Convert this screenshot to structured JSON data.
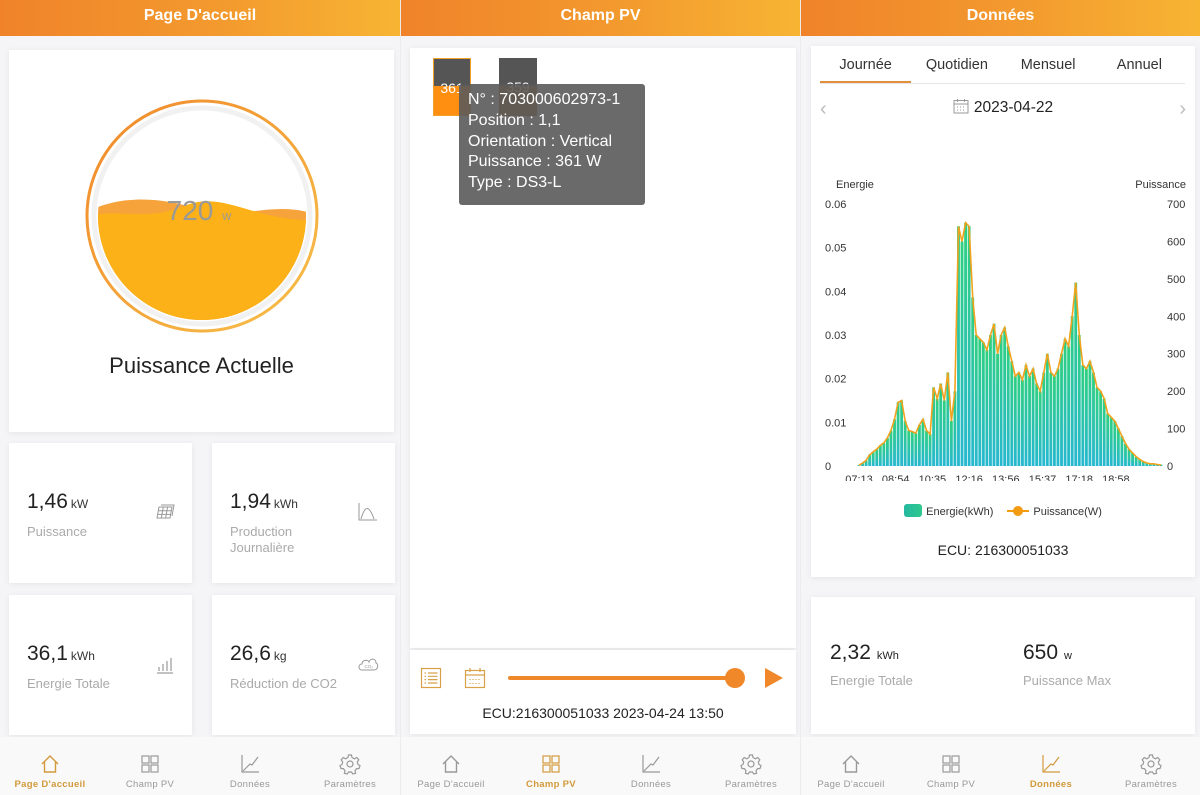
{
  "screens": {
    "home": {
      "title": "Page D'accueil",
      "gauge": {
        "value": "720",
        "unit": "W",
        "fill_fraction": 0.45,
        "label": "Puissance Actuelle"
      },
      "stats": [
        {
          "value": "1,46",
          "unit": "kW",
          "label": "Puissance",
          "icon": "solar-panel-icon"
        },
        {
          "value": "1,94",
          "unit": "kWh",
          "label": "Production Journalière",
          "icon": "bell-curve-icon"
        },
        {
          "value": "36,1",
          "unit": "kWh",
          "label": "Energie Totale",
          "icon": "bar-chart-icon"
        },
        {
          "value": "26,6",
          "unit": "kg",
          "label": "Réduction de CO2",
          "icon": "co2-cloud-icon"
        }
      ]
    },
    "field": {
      "title": "Champ PV",
      "panels": [
        {
          "value": "361",
          "fill_fraction": 0.52,
          "selected": true
        },
        {
          "value": "359",
          "fill_fraction": 0.52,
          "selected": false
        }
      ],
      "tooltip": {
        "lines": [
          "N° : 703000602973-1",
          "Position : 1,1",
          "Orientation : Vertical",
          "Puissance : 361 W",
          "Type : DS3-L"
        ]
      },
      "slider_fraction": 1.0,
      "ecu_line": "ECU:216300051033 2023-04-24 13:50"
    },
    "data": {
      "title": "Données",
      "tabs": [
        "Journée",
        "Quotidien",
        "Mensuel",
        "Annuel"
      ],
      "active_tab": 0,
      "date": "2023-04-22",
      "ecu": "ECU:  216300051033",
      "legend": {
        "energy": "Energie(kWh)",
        "power": "Puissance(W)"
      },
      "summary": [
        {
          "value": "2,32",
          "unit": "kWh",
          "label": "Energie Totale"
        },
        {
          "value": "650",
          "unit": "w",
          "label": "Puissance Max"
        }
      ]
    }
  },
  "tabbar": {
    "items": [
      {
        "label": "Page D'accueil",
        "icon": "home-icon"
      },
      {
        "label": "Champ PV",
        "icon": "grid-icon"
      },
      {
        "label": "Données",
        "icon": "line-chart-icon"
      },
      {
        "label": "Paramètres",
        "icon": "gear-icon"
      }
    ]
  },
  "colors": {
    "accent": "#f0882a",
    "active_tab": "#d29a3c",
    "energy": "#2ec88f",
    "power": "#f39c12"
  },
  "chart_data": {
    "type": "bar",
    "title": "",
    "ylabel_left": "Energie",
    "ylabel_right": "Puissance",
    "left_ticks": [
      "0",
      "0.01",
      "0.02",
      "0.03",
      "0.04",
      "0.05",
      "0.06"
    ],
    "right_ticks": [
      "0",
      "100",
      "200",
      "300",
      "400",
      "500",
      "600",
      "700"
    ],
    "ylim_left": [
      0,
      0.06
    ],
    "ylim_right": [
      0,
      700
    ],
    "x_ticks": [
      "07:13",
      "08:54",
      "10:35",
      "12:16",
      "13:56",
      "15:37",
      "17:18",
      "18:58"
    ],
    "x_range": [
      "07:13",
      "19:36"
    ],
    "grid": false,
    "legend_position": "bottom",
    "series": [
      {
        "name": "Puissance(W)",
        "type": "line",
        "axis": "right",
        "values": [
          2,
          8,
          15,
          30,
          38,
          45,
          55,
          62,
          75,
          95,
          125,
          170,
          175,
          120,
          95,
          92,
          88,
          110,
          125,
          95,
          85,
          210,
          180,
          220,
          175,
          250,
          120,
          200,
          640,
          600,
          650,
          640,
          450,
          350,
          340,
          330,
          310,
          350,
          380,
          300,
          350,
          370,
          320,
          280,
          240,
          250,
          230,
          270,
          240,
          260,
          220,
          200,
          250,
          300,
          250,
          240,
          260,
          300,
          340,
          320,
          400,
          490,
          350,
          270,
          260,
          280,
          250,
          210,
          200,
          180,
          140,
          130,
          120,
          100,
          80,
          60,
          45,
          35,
          25,
          18,
          12,
          8,
          6,
          6,
          4,
          3
        ]
      },
      {
        "name": "Energie(kWh)",
        "type": "bar",
        "axis": "left",
        "values": [
          0.0002,
          0.0007,
          0.0013,
          0.0026,
          0.0033,
          0.0039,
          0.0047,
          0.0053,
          0.0064,
          0.0081,
          0.0107,
          0.0146,
          0.015,
          0.0103,
          0.0081,
          0.0079,
          0.0075,
          0.0094,
          0.0107,
          0.0081,
          0.0073,
          0.018,
          0.0154,
          0.0189,
          0.015,
          0.0214,
          0.0103,
          0.0171,
          0.0549,
          0.0514,
          0.0557,
          0.0549,
          0.0386,
          0.03,
          0.0291,
          0.0283,
          0.0266,
          0.03,
          0.0326,
          0.0257,
          0.03,
          0.0317,
          0.0274,
          0.024,
          0.0206,
          0.0214,
          0.0197,
          0.0231,
          0.0206,
          0.0223,
          0.0189,
          0.0171,
          0.0214,
          0.0257,
          0.0214,
          0.0206,
          0.0223,
          0.0257,
          0.0291,
          0.0274,
          0.0343,
          0.042,
          0.03,
          0.0231,
          0.0223,
          0.024,
          0.0214,
          0.018,
          0.0171,
          0.0154,
          0.012,
          0.0111,
          0.0103,
          0.0086,
          0.0069,
          0.0051,
          0.0039,
          0.003,
          0.0021,
          0.0015,
          0.001,
          0.0007,
          0.0005,
          0.0005,
          0.0003,
          0.0003
        ]
      }
    ]
  }
}
